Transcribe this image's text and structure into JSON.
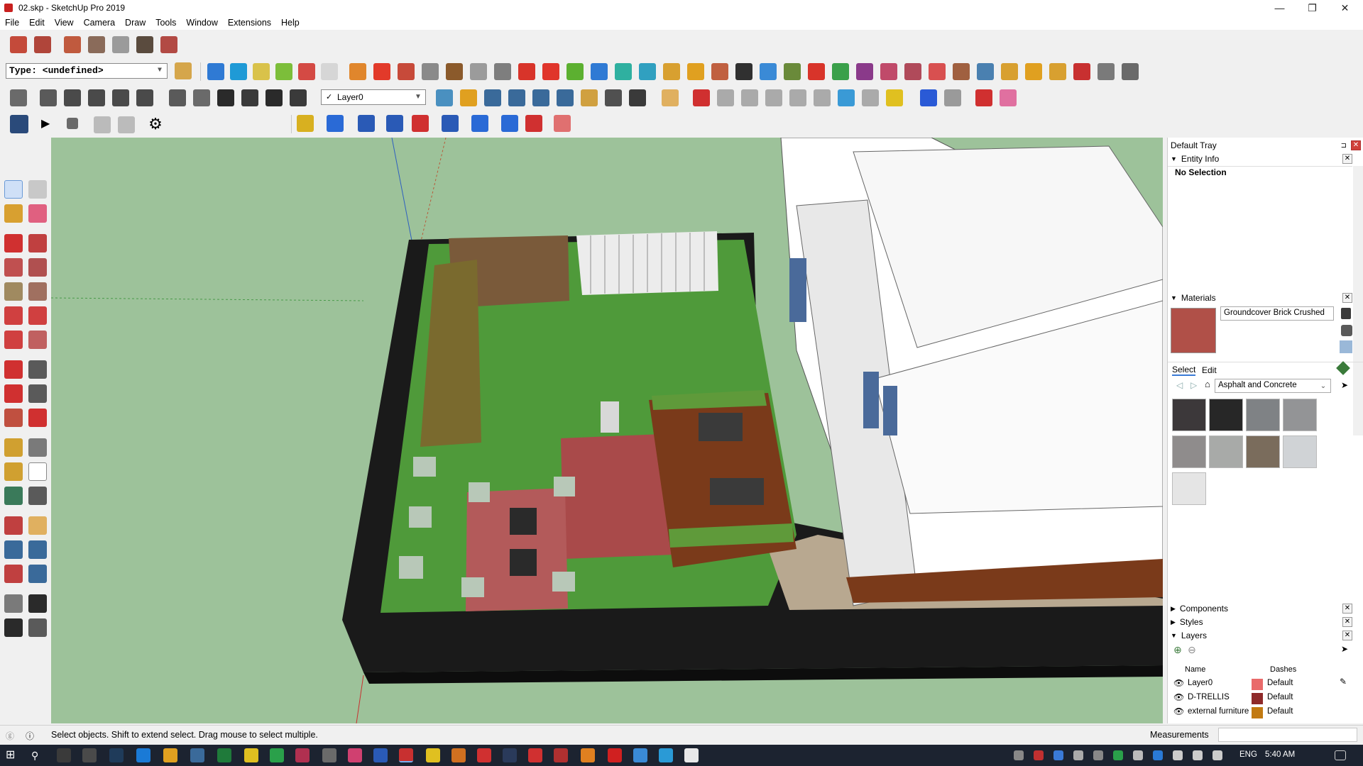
{
  "window": {
    "title": "02.skp - SketchUp Pro 2019",
    "minimize": "—",
    "maximize": "❐",
    "close": "✕"
  },
  "menu": [
    "File",
    "Edit",
    "View",
    "Camera",
    "Draw",
    "Tools",
    "Window",
    "Extensions",
    "Help"
  ],
  "toolbar": {
    "type_select": "Type: <undefined>",
    "layer_select": "Layer0",
    "layer_check": "✓"
  },
  "tray": {
    "title": "Default Tray",
    "entity_info": {
      "label": "Entity Info",
      "status": "No Selection"
    },
    "materials": {
      "label": "Materials",
      "current_name": "Groundcover Brick Crushed",
      "tab_select": "Select",
      "tab_edit": "Edit",
      "library": "Asphalt and Concrete",
      "swatches": [
        "#3c383a",
        "#272727",
        "#7f8285",
        "#939496",
        "#8f8c8c",
        "#a8aaa8",
        "#7a6c5c",
        "#d0d3d6",
        "#e5e5e5"
      ]
    },
    "components": "Components",
    "styles": "Styles",
    "layers": {
      "label": "Layers",
      "col_name": "Name",
      "col_dashes": "Dashes",
      "rows": [
        {
          "name": "Layer0",
          "dashes": "Default",
          "color": "#e96a6a"
        },
        {
          "name": "D-TRELLIS",
          "dashes": "Default",
          "color": "#8f2a2a"
        },
        {
          "name": "external furniture",
          "dashes": "Default",
          "color": "#c27a12"
        }
      ]
    }
  },
  "status": {
    "message": "Select objects. Shift to extend select. Drag mouse to select multiple.",
    "measurements_label": "Measurements"
  },
  "taskbar": {
    "lang": "ENG",
    "time": "5:40 AM"
  }
}
